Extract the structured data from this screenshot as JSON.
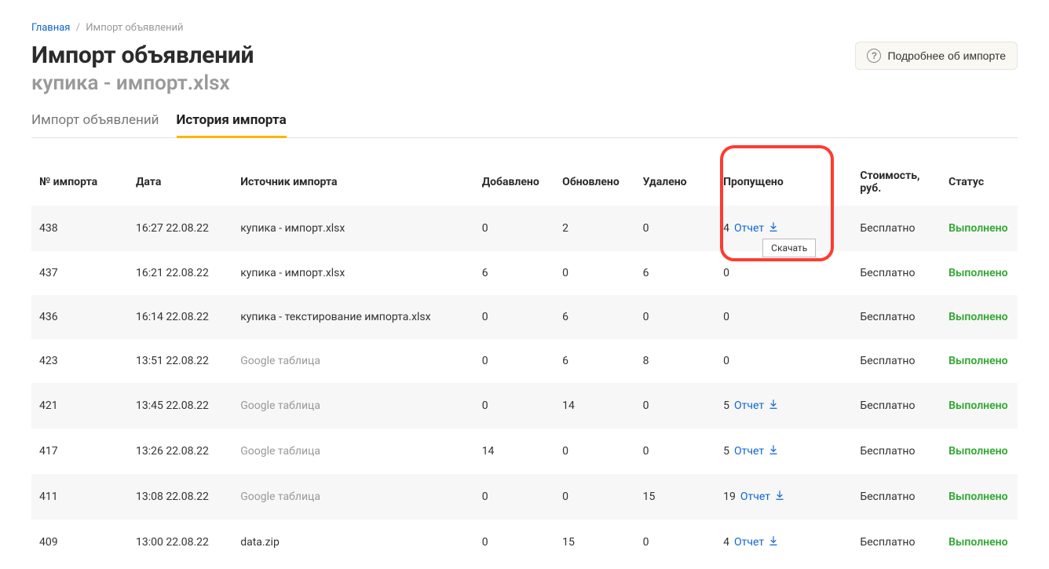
{
  "breadcrumb": {
    "home": "Главная",
    "current": "Импорт объявлений"
  },
  "title": "Импорт объявлений",
  "subtitle": "купика - импорт.xlsx",
  "more_label": "Подробнее об импорте",
  "tabs": {
    "import": "Импорт объявлений",
    "history": "История импорта"
  },
  "table": {
    "headers": {
      "id": "№ импорта",
      "date": "Дата",
      "source": "Источник импорта",
      "added": "Добавлено",
      "updated": "Обновлено",
      "deleted": "Удалено",
      "skipped": "Пропущено",
      "cost": "Стоимость, руб.",
      "status": "Статус"
    },
    "report_label": "Отчет",
    "tooltip": "Скачать",
    "rows": [
      {
        "id": "438",
        "date": "16:27 22.08.22",
        "source": "купика - импорт.xlsx",
        "source_grey": false,
        "added": "0",
        "updated": "2",
        "deleted": "0",
        "skipped": "4",
        "has_report": true,
        "cost": "Бесплатно",
        "status": "Выполнено",
        "show_tooltip": true
      },
      {
        "id": "437",
        "date": "16:21 22.08.22",
        "source": "купика - импорт.xlsx",
        "source_grey": false,
        "added": "6",
        "updated": "0",
        "deleted": "6",
        "skipped": "0",
        "has_report": false,
        "cost": "Бесплатно",
        "status": "Выполнено"
      },
      {
        "id": "436",
        "date": "16:14 22.08.22",
        "source": "купика - текстирование импорта.xlsx",
        "source_grey": false,
        "added": "0",
        "updated": "6",
        "deleted": "0",
        "skipped": "0",
        "has_report": false,
        "cost": "Бесплатно",
        "status": "Выполнено"
      },
      {
        "id": "423",
        "date": "13:51 22.08.22",
        "source": "Google таблица",
        "source_grey": true,
        "added": "0",
        "updated": "6",
        "deleted": "8",
        "skipped": "0",
        "has_report": false,
        "cost": "Бесплатно",
        "status": "Выполнено"
      },
      {
        "id": "421",
        "date": "13:45 22.08.22",
        "source": "Google таблица",
        "source_grey": true,
        "added": "0",
        "updated": "14",
        "deleted": "0",
        "skipped": "5",
        "has_report": true,
        "cost": "Бесплатно",
        "status": "Выполнено"
      },
      {
        "id": "417",
        "date": "13:26 22.08.22",
        "source": "Google таблица",
        "source_grey": true,
        "added": "14",
        "updated": "0",
        "deleted": "0",
        "skipped": "5",
        "has_report": true,
        "cost": "Бесплатно",
        "status": "Выполнено"
      },
      {
        "id": "411",
        "date": "13:08 22.08.22",
        "source": "Google таблица",
        "source_grey": true,
        "added": "0",
        "updated": "0",
        "deleted": "15",
        "skipped": "19",
        "has_report": true,
        "cost": "Бесплатно",
        "status": "Выполнено"
      },
      {
        "id": "409",
        "date": "13:00 22.08.22",
        "source": "data.zip",
        "source_grey": false,
        "added": "0",
        "updated": "15",
        "deleted": "0",
        "skipped": "4",
        "has_report": true,
        "cost": "Бесплатно",
        "status": "Выполнено"
      }
    ]
  }
}
